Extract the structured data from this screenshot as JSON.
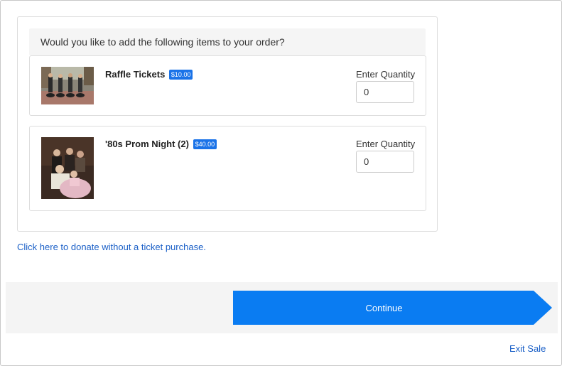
{
  "prompt": "Would you like to add the following items to your order?",
  "items": [
    {
      "name": "Raffle Tickets",
      "price": "$10.00",
      "quantity_label": "Enter Quantity",
      "quantity": "0"
    },
    {
      "name": "'80s Prom Night (2)",
      "price": "$40.00",
      "quantity_label": "Enter Quantity",
      "quantity": "0"
    }
  ],
  "donate_link": "Click here to donate without a ticket purchase.",
  "continue_label": "Continue",
  "exit_label": "Exit Sale",
  "colors": {
    "accent": "#0a7cf2",
    "badge": "#1a73e8",
    "link": "#1a5fc7"
  }
}
